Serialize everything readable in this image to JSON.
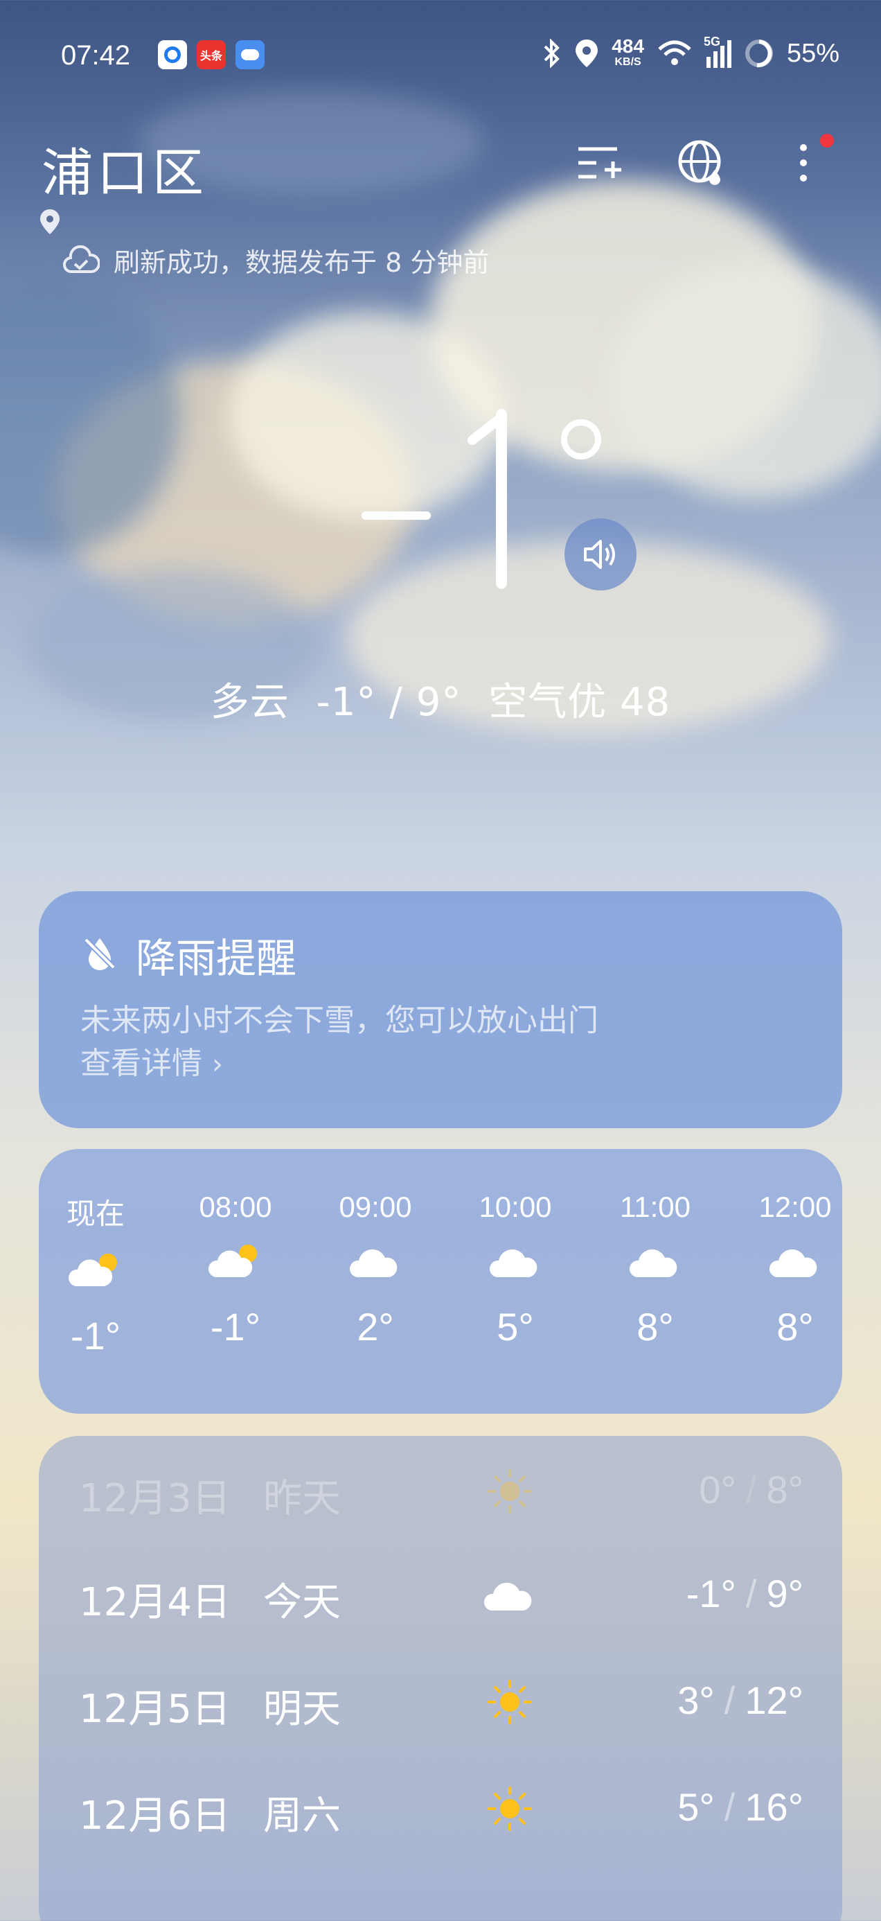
{
  "status_bar": {
    "time": "07:42",
    "speed_value": "484",
    "speed_unit": "KB/S",
    "network": "5G",
    "battery": "55%",
    "icons": [
      "bluetooth-icon",
      "location-icon",
      "wifi-icon",
      "signal-icon",
      "battery-icon"
    ]
  },
  "header": {
    "city": "浦口区",
    "refresh_text": "刷新成功，数据发布于 8 分钟前",
    "icons": [
      "add-city-icon",
      "globe-icon",
      "more-icon"
    ]
  },
  "current": {
    "temperature": "-1",
    "condition": "多云",
    "range": "-1° / 9°",
    "air_quality": "空气优 48"
  },
  "rain_alert": {
    "title": "降雨提醒",
    "description": "未来两小时不会下雪，您可以放心出门",
    "link": "查看详情"
  },
  "hourly": [
    {
      "time": "现在",
      "temp": "-1°",
      "icon": "partly-cloudy-icon"
    },
    {
      "time": "08:00",
      "temp": "-1°",
      "icon": "partly-cloudy-icon"
    },
    {
      "time": "09:00",
      "temp": "2°",
      "icon": "cloud-icon"
    },
    {
      "time": "10:00",
      "temp": "5°",
      "icon": "cloud-icon"
    },
    {
      "time": "11:00",
      "temp": "8°",
      "icon": "cloud-icon"
    },
    {
      "time": "12:00",
      "temp": "8°",
      "icon": "cloud-icon"
    }
  ],
  "daily": [
    {
      "date": "12月3日",
      "name": "昨天",
      "icon": "sun-icon",
      "low": "0°",
      "high": "8°"
    },
    {
      "date": "12月4日",
      "name": "今天",
      "icon": "cloud-icon",
      "low": "-1°",
      "high": "9°"
    },
    {
      "date": "12月5日",
      "name": "明天",
      "icon": "sun-icon",
      "low": "3°",
      "high": "12°"
    },
    {
      "date": "12月6日",
      "name": "周六",
      "icon": "sun-icon",
      "low": "5°",
      "high": "16°"
    }
  ],
  "colors": {
    "sun": "#FFC21A",
    "card_blue": "#7C9EDA",
    "notification_dot": "#F0363F"
  }
}
